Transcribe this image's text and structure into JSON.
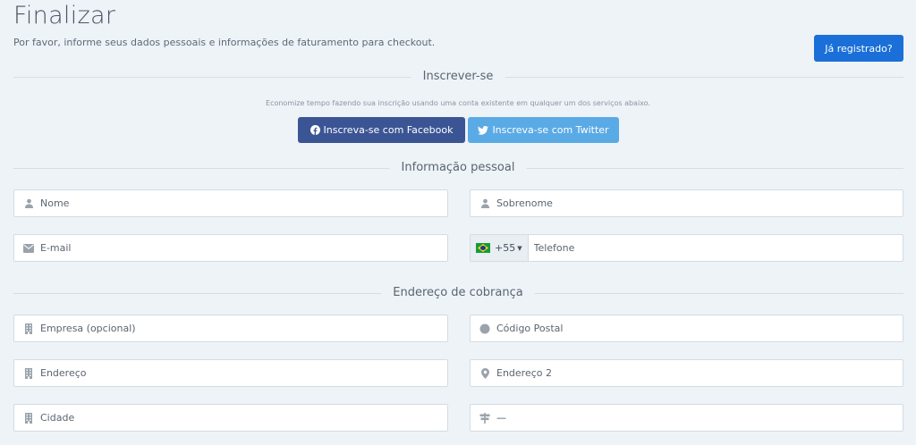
{
  "header": {
    "title": "Finalizar",
    "subtitle": "Por favor, informe seus dados pessoais e informações de faturamento para checkout.",
    "registered_button": "Já registrado?"
  },
  "signup": {
    "section_title": "Inscrever-se",
    "helper": "Economize tempo fazendo sua inscrição usando uma conta existente em qualquer um dos serviços abaixo.",
    "facebook_label": "Inscreva-se com Facebook",
    "twitter_label": "Inscreva-se com Twitter"
  },
  "personal": {
    "section_title": "Informação pessoal",
    "first_name_placeholder": "Nome",
    "last_name_placeholder": "Sobrenome",
    "email_placeholder": "E-mail",
    "phone_dial_code": "+55",
    "phone_placeholder": "Telefone"
  },
  "billing": {
    "section_title": "Endereço de cobrança",
    "company_placeholder": "Empresa (opcional)",
    "postal_placeholder": "Código Postal",
    "address_placeholder": "Endereço",
    "address2_placeholder": "Endereço 2",
    "city_placeholder": "Cidade",
    "state_value": "—"
  },
  "colors": {
    "background": "#eef3f8",
    "primary": "#1a6fd8",
    "facebook": "#3b5594",
    "twitter": "#5aaae6",
    "icon": "#9aa3ac"
  }
}
